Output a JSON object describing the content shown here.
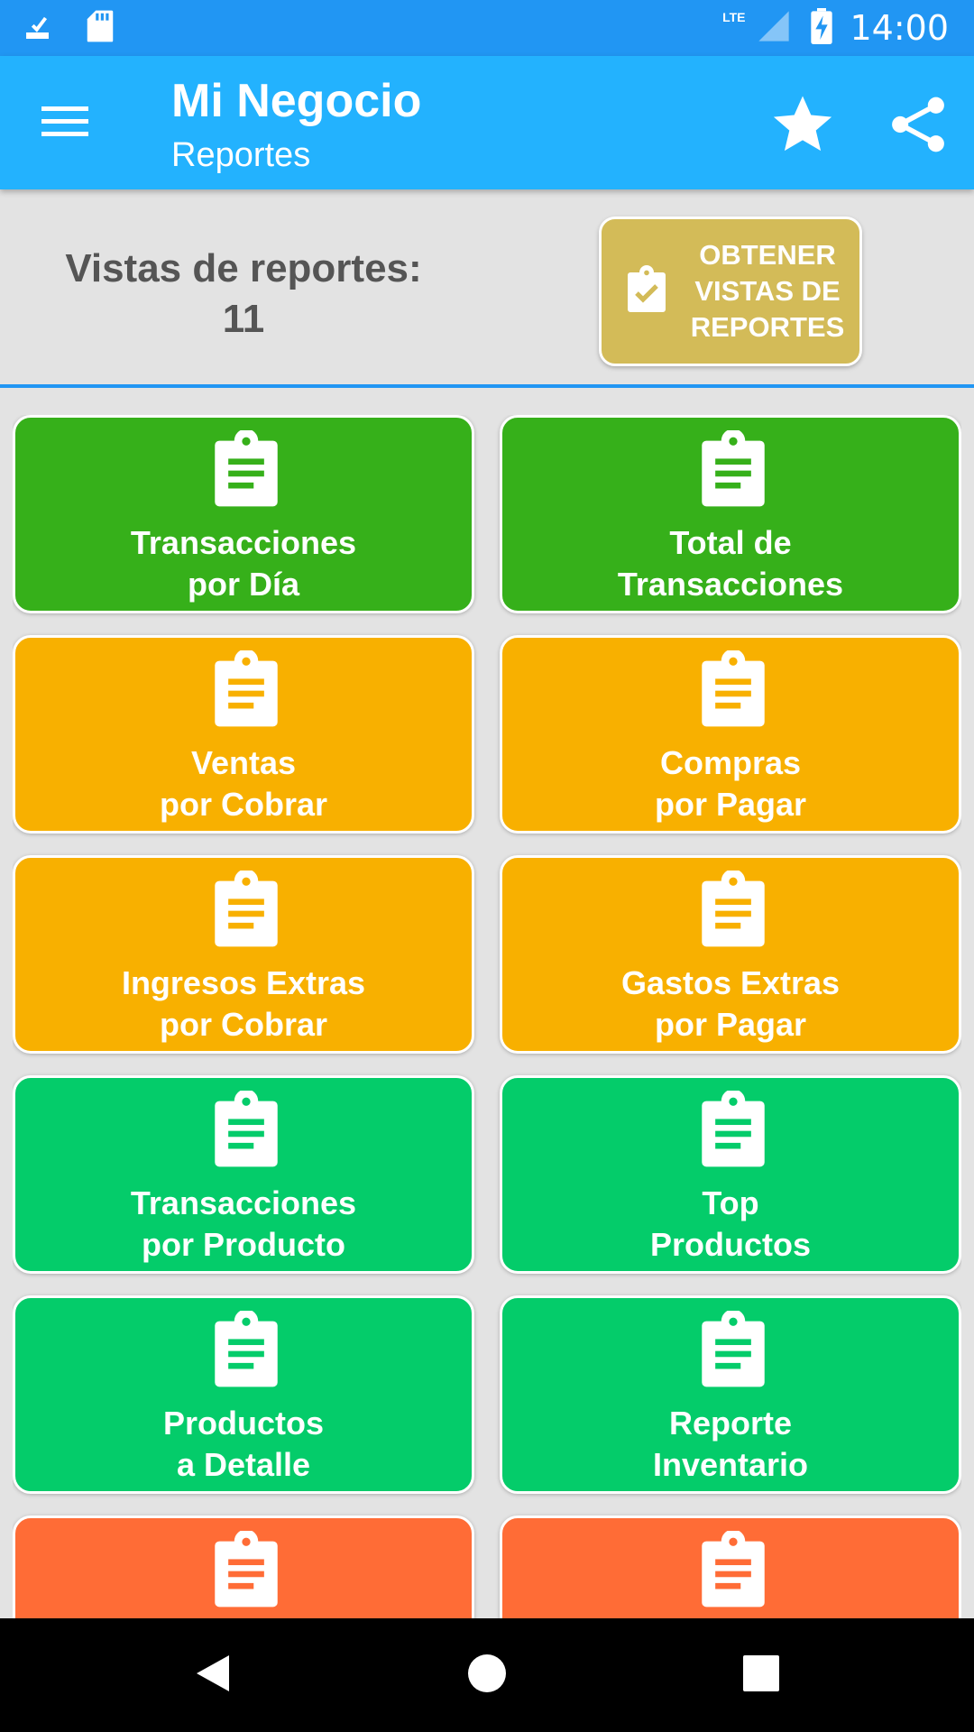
{
  "status_bar": {
    "network": "LTE",
    "time": "14:00"
  },
  "app_bar": {
    "title": "Mi Negocio",
    "subtitle": "Reportes"
  },
  "report_views": {
    "label": "Vistas de reportes:",
    "count": "11",
    "button_lines": [
      "OBTENER",
      "VISTAS DE",
      "REPORTES"
    ]
  },
  "colors": {
    "status_bar": "#2196f3",
    "app_bar": "#23b2fe",
    "gold_button": "#d3bb58",
    "green_dark": "#36b01a",
    "yellow": "#f8b000",
    "green_light": "#04cc6a",
    "orange": "#ff6c36"
  },
  "tiles": [
    {
      "line1": "Transacciones",
      "line2": "por Día",
      "color": "green1",
      "icon": "clipboard-list-icon"
    },
    {
      "line1": "Total de",
      "line2": "Transacciones",
      "color": "green1",
      "icon": "clipboard-list-icon"
    },
    {
      "line1": "Ventas",
      "line2": "por Cobrar",
      "color": "yellow",
      "icon": "clipboard-list-icon"
    },
    {
      "line1": "Compras",
      "line2": "por Pagar",
      "color": "yellow",
      "icon": "clipboard-list-icon"
    },
    {
      "line1": "Ingresos Extras",
      "line2": "por Cobrar",
      "color": "yellow",
      "icon": "clipboard-list-icon"
    },
    {
      "line1": "Gastos Extras",
      "line2": "por Pagar",
      "color": "yellow",
      "icon": "clipboard-list-icon"
    },
    {
      "line1": "Transacciones",
      "line2": "por Producto",
      "color": "green2",
      "icon": "clipboard-list-icon"
    },
    {
      "line1": "Top",
      "line2": "Productos",
      "color": "green2",
      "icon": "clipboard-list-icon"
    },
    {
      "line1": "Productos",
      "line2": "a Detalle",
      "color": "green2",
      "icon": "clipboard-list-icon"
    },
    {
      "line1": "Reporte",
      "line2": "Inventario",
      "color": "green2",
      "icon": "clipboard-list-icon"
    },
    {
      "line1": "",
      "line2": "",
      "color": "orange",
      "icon": "clipboard-list-icon"
    },
    {
      "line1": "",
      "line2": "",
      "color": "orange",
      "icon": "clipboard-list-icon"
    }
  ]
}
